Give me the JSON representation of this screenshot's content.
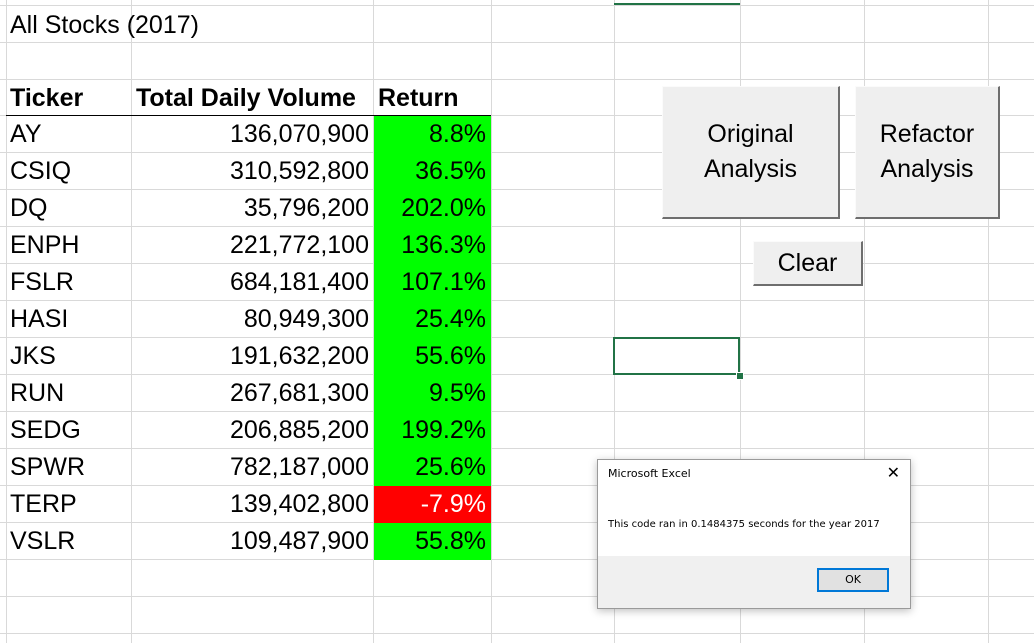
{
  "sheet": {
    "title": "All Stocks (2017)",
    "headers": {
      "ticker": "Ticker",
      "volume": "Total Daily Volume",
      "return": "Return"
    },
    "rows": [
      {
        "ticker": "AY",
        "volume": "136,070,900",
        "return": "8.8%",
        "positive": true
      },
      {
        "ticker": "CSIQ",
        "volume": "310,592,800",
        "return": "36.5%",
        "positive": true
      },
      {
        "ticker": "DQ",
        "volume": "35,796,200",
        "return": "202.0%",
        "positive": true
      },
      {
        "ticker": "ENPH",
        "volume": "221,772,100",
        "return": "136.3%",
        "positive": true
      },
      {
        "ticker": "FSLR",
        "volume": "684,181,400",
        "return": "107.1%",
        "positive": true
      },
      {
        "ticker": "HASI",
        "volume": "80,949,300",
        "return": "25.4%",
        "positive": true
      },
      {
        "ticker": "JKS",
        "volume": "191,632,200",
        "return": "55.6%",
        "positive": true
      },
      {
        "ticker": "RUN",
        "volume": "267,681,300",
        "return": "9.5%",
        "positive": true
      },
      {
        "ticker": "SEDG",
        "volume": "206,885,200",
        "return": "199.2%",
        "positive": true
      },
      {
        "ticker": "SPWR",
        "volume": "782,187,000",
        "return": "25.6%",
        "positive": true
      },
      {
        "ticker": "TERP",
        "volume": "139,402,800",
        "return": "-7.9%",
        "positive": false
      },
      {
        "ticker": "VSLR",
        "volume": "109,487,900",
        "return": "55.8%",
        "positive": true
      }
    ]
  },
  "buttons": {
    "original": "Original\nAnalysis",
    "refactor": "Refactor\nAnalysis",
    "clear": "Clear"
  },
  "dialog": {
    "title": "Microsoft Excel",
    "message": "This code ran in 0.1484375 seconds for the year 2017",
    "ok_label": "OK",
    "close_glyph": "✕"
  },
  "colors": {
    "positive": "#00ff00",
    "negative": "#ff0000",
    "accent": "#217346"
  }
}
